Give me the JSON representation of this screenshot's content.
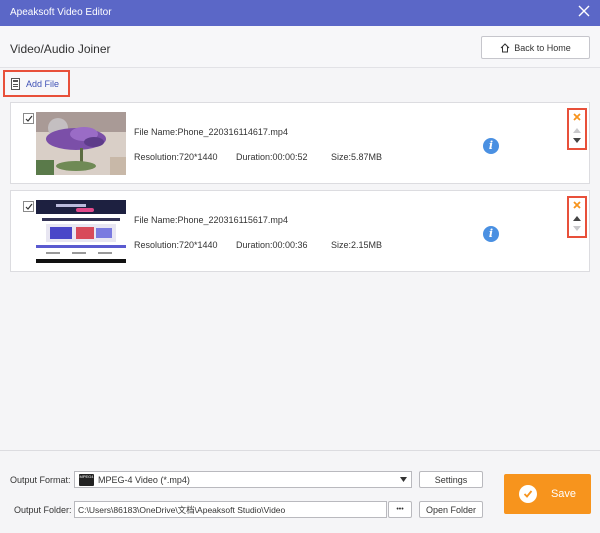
{
  "app": {
    "title": "Apeaksoft Video Editor"
  },
  "header": {
    "page_title": "Video/Audio Joiner",
    "back_label": "Back to Home"
  },
  "toolbar": {
    "add_file_label": "Add File"
  },
  "files": [
    {
      "checked": true,
      "file_name": "File Name:Phone_220316114617.mp4",
      "resolution": "Resolution:720*1440",
      "duration": "Duration:00:00:52",
      "size": "Size:5.87MB"
    },
    {
      "checked": true,
      "file_name": "File Name:Phone_220316115617.mp4",
      "resolution": "Resolution:720*1440",
      "duration": "Duration:00:00:36",
      "size": "Size:2.15MB"
    }
  ],
  "footer": {
    "output_format_label": "Output Format:",
    "output_format_value": "MPEG-4 Video (*.mp4)",
    "format_icon_text": "MPEG4",
    "settings_label": "Settings",
    "output_folder_label": "Output Folder:",
    "output_folder_value": "C:\\Users\\86183\\OneDrive\\文档\\Apeaksoft Studio\\Video",
    "browse_label": "•••",
    "open_folder_label": "Open Folder",
    "save_label": "Save"
  },
  "colors": {
    "titlebar": "#5b67c7",
    "accent_red": "#e8503a",
    "save_orange": "#f7941d",
    "info_blue": "#4a90e2",
    "link_blue": "#3f51b5"
  },
  "icons": {
    "close": "close-icon",
    "home": "home-icon",
    "add_file": "add-file-icon",
    "info": "info-icon",
    "remove": "remove-icon",
    "move_up": "arrow-up-icon",
    "move_down": "arrow-down-icon",
    "save": "check-icon"
  }
}
